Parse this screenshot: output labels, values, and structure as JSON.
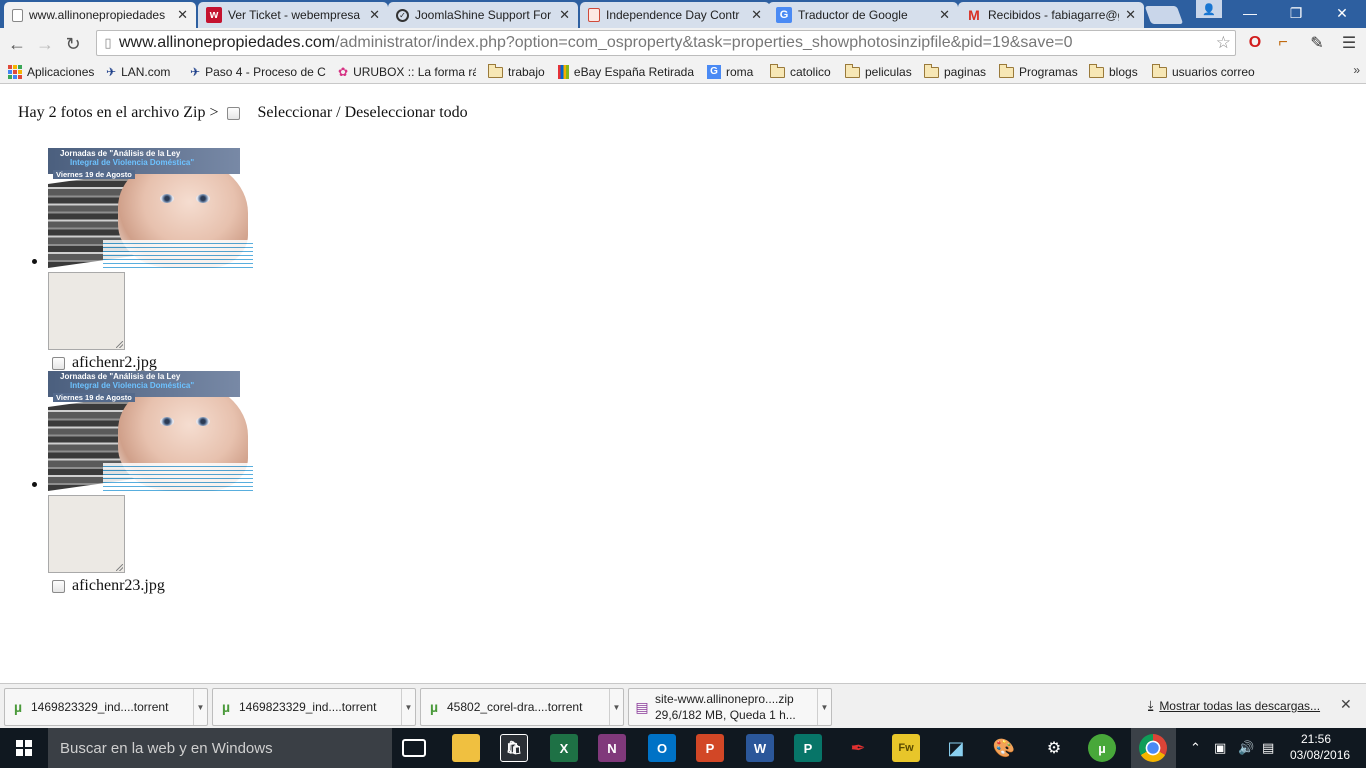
{
  "browser": {
    "tabs": [
      {
        "title": "www.allinonepropiedades",
        "favicon": "page-icon"
      },
      {
        "title": "Ver Ticket - webempresa",
        "favicon": "webempresa-icon"
      },
      {
        "title": "JoomlaShine Support For",
        "favicon": "joomlashine-icon"
      },
      {
        "title": "Independence Day Contr",
        "favicon": "document-icon"
      },
      {
        "title": "Traductor de Google",
        "favicon": "google-translate-icon"
      },
      {
        "title": "Recibidos - fabiagarre@g",
        "favicon": "gmail-icon"
      }
    ],
    "url": {
      "host": "www.allinonepropiedades.com",
      "path": "/administrator/index.php?option=com_osproperty&task=properties_showphotosinzipfile&pid=19&save=0"
    },
    "bookmarks": [
      "Aplicaciones",
      "LAN.com",
      "Paso 4 - Proceso de C",
      "URUBOX :: La forma rá",
      "trabajo",
      "eBay España Retirada",
      "roma",
      "catolico",
      "peliculas",
      "paginas",
      "Programas",
      "blogs",
      "usuarios correo"
    ],
    "more_bookmarks": "»"
  },
  "page": {
    "header": "Hay 2 fotos en el archivo Zip >",
    "select_all_label": "Seleccionar / Deseleccionar todo",
    "photos": [
      {
        "filename": "afichenr2.jpg",
        "thumb_title": "Jornadas de \"Análisis de la Ley",
        "thumb_subtitle": "Integral de Violencia Doméstica\"",
        "thumb_date": "Viernes 19 de Agosto"
      },
      {
        "filename": "afichenr23.jpg",
        "thumb_title": "Jornadas de \"Análisis de la Ley",
        "thumb_subtitle": "Integral de Violencia Doméstica\"",
        "thumb_date": "Viernes 19 de Agosto"
      }
    ]
  },
  "downloads": {
    "items": [
      {
        "name": "1469823329_ind....torrent",
        "detail": ""
      },
      {
        "name": "1469823329_ind....torrent",
        "detail": ""
      },
      {
        "name": "45802_corel-dra....torrent",
        "detail": ""
      },
      {
        "name": "site-www.allinonepro....zip",
        "detail": "29,6/182 MB, Queda 1 h..."
      }
    ],
    "show_all": "Mostrar todas las descargas..."
  },
  "taskbar": {
    "search_placeholder": "Buscar en la web y en Windows",
    "time": "21:56",
    "date": "03/08/2016"
  }
}
